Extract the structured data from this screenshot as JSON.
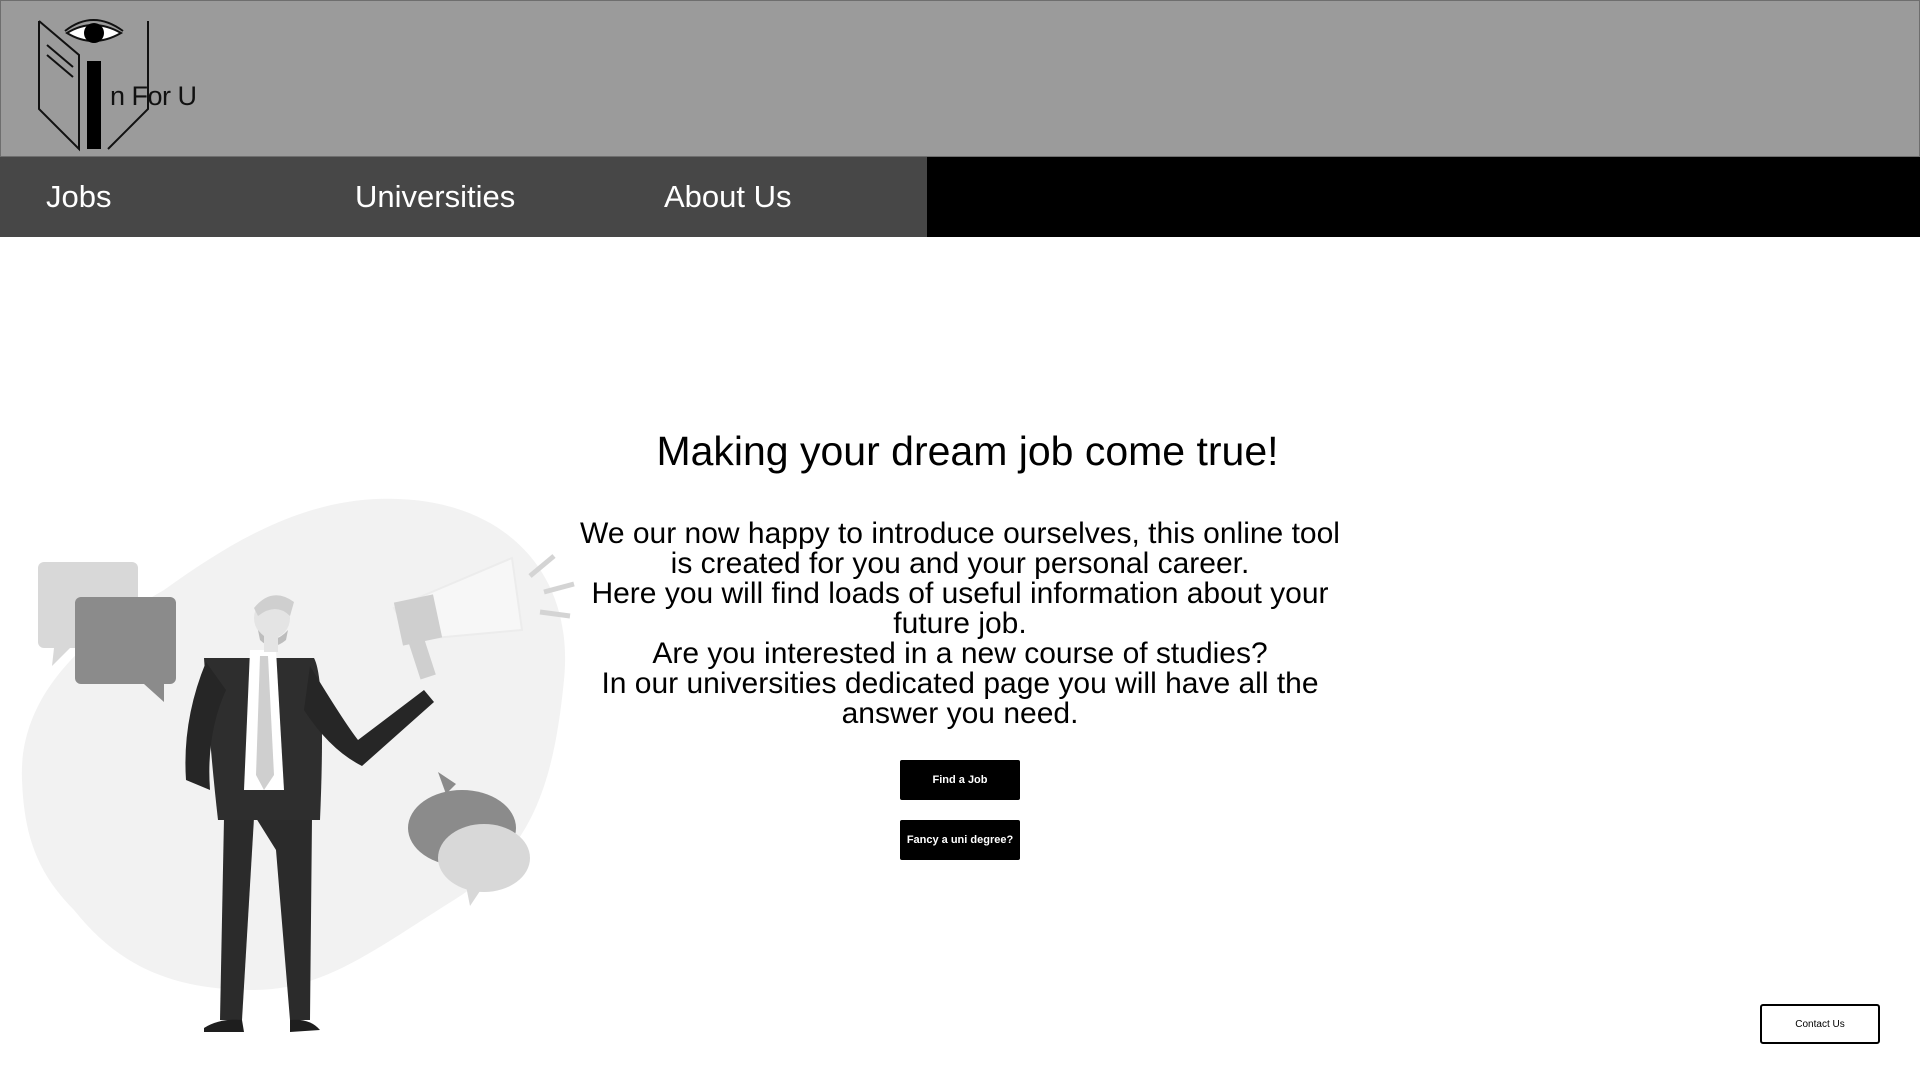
{
  "header": {
    "logo_text": "n For U",
    "logo_icon": "book-eye-icon"
  },
  "nav": {
    "items": [
      {
        "label": "Jobs"
      },
      {
        "label": "Universities"
      },
      {
        "label": "About Us"
      }
    ]
  },
  "hero": {
    "title": "Making your dream job come true!",
    "lines": [
      "We our now happy to introduce ourselves, this online tool",
      "is created for you and your personal career.",
      "Here you will find loads of useful information about your",
      "future job.",
      "Are you interested in a new course of studies?",
      "In our universities dedicated page you will have all the",
      "answer you need."
    ],
    "find_job_label": "Find a Job",
    "uni_degree_label": "Fancy a uni degree?"
  },
  "footer": {
    "contact_label": "Contact Us"
  },
  "colors": {
    "header_bg": "#9b9b9b",
    "nav_bg": "#474747",
    "nav_fill": "#000000",
    "button_bg": "#000000"
  }
}
